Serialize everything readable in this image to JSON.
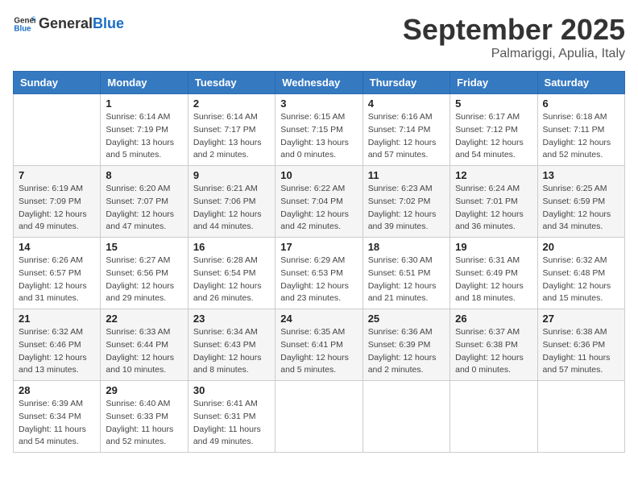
{
  "logo": {
    "text_general": "General",
    "text_blue": "Blue"
  },
  "header": {
    "month": "September 2025",
    "location": "Palmariggi, Apulia, Italy"
  },
  "days_of_week": [
    "Sunday",
    "Monday",
    "Tuesday",
    "Wednesday",
    "Thursday",
    "Friday",
    "Saturday"
  ],
  "weeks": [
    [
      {
        "day": "",
        "info": ""
      },
      {
        "day": "1",
        "info": "Sunrise: 6:14 AM\nSunset: 7:19 PM\nDaylight: 13 hours\nand 5 minutes."
      },
      {
        "day": "2",
        "info": "Sunrise: 6:14 AM\nSunset: 7:17 PM\nDaylight: 13 hours\nand 2 minutes."
      },
      {
        "day": "3",
        "info": "Sunrise: 6:15 AM\nSunset: 7:15 PM\nDaylight: 13 hours\nand 0 minutes."
      },
      {
        "day": "4",
        "info": "Sunrise: 6:16 AM\nSunset: 7:14 PM\nDaylight: 12 hours\nand 57 minutes."
      },
      {
        "day": "5",
        "info": "Sunrise: 6:17 AM\nSunset: 7:12 PM\nDaylight: 12 hours\nand 54 minutes."
      },
      {
        "day": "6",
        "info": "Sunrise: 6:18 AM\nSunset: 7:11 PM\nDaylight: 12 hours\nand 52 minutes."
      }
    ],
    [
      {
        "day": "7",
        "info": "Sunrise: 6:19 AM\nSunset: 7:09 PM\nDaylight: 12 hours\nand 49 minutes."
      },
      {
        "day": "8",
        "info": "Sunrise: 6:20 AM\nSunset: 7:07 PM\nDaylight: 12 hours\nand 47 minutes."
      },
      {
        "day": "9",
        "info": "Sunrise: 6:21 AM\nSunset: 7:06 PM\nDaylight: 12 hours\nand 44 minutes."
      },
      {
        "day": "10",
        "info": "Sunrise: 6:22 AM\nSunset: 7:04 PM\nDaylight: 12 hours\nand 42 minutes."
      },
      {
        "day": "11",
        "info": "Sunrise: 6:23 AM\nSunset: 7:02 PM\nDaylight: 12 hours\nand 39 minutes."
      },
      {
        "day": "12",
        "info": "Sunrise: 6:24 AM\nSunset: 7:01 PM\nDaylight: 12 hours\nand 36 minutes."
      },
      {
        "day": "13",
        "info": "Sunrise: 6:25 AM\nSunset: 6:59 PM\nDaylight: 12 hours\nand 34 minutes."
      }
    ],
    [
      {
        "day": "14",
        "info": "Sunrise: 6:26 AM\nSunset: 6:57 PM\nDaylight: 12 hours\nand 31 minutes."
      },
      {
        "day": "15",
        "info": "Sunrise: 6:27 AM\nSunset: 6:56 PM\nDaylight: 12 hours\nand 29 minutes."
      },
      {
        "day": "16",
        "info": "Sunrise: 6:28 AM\nSunset: 6:54 PM\nDaylight: 12 hours\nand 26 minutes."
      },
      {
        "day": "17",
        "info": "Sunrise: 6:29 AM\nSunset: 6:53 PM\nDaylight: 12 hours\nand 23 minutes."
      },
      {
        "day": "18",
        "info": "Sunrise: 6:30 AM\nSunset: 6:51 PM\nDaylight: 12 hours\nand 21 minutes."
      },
      {
        "day": "19",
        "info": "Sunrise: 6:31 AM\nSunset: 6:49 PM\nDaylight: 12 hours\nand 18 minutes."
      },
      {
        "day": "20",
        "info": "Sunrise: 6:32 AM\nSunset: 6:48 PM\nDaylight: 12 hours\nand 15 minutes."
      }
    ],
    [
      {
        "day": "21",
        "info": "Sunrise: 6:32 AM\nSunset: 6:46 PM\nDaylight: 12 hours\nand 13 minutes."
      },
      {
        "day": "22",
        "info": "Sunrise: 6:33 AM\nSunset: 6:44 PM\nDaylight: 12 hours\nand 10 minutes."
      },
      {
        "day": "23",
        "info": "Sunrise: 6:34 AM\nSunset: 6:43 PM\nDaylight: 12 hours\nand 8 minutes."
      },
      {
        "day": "24",
        "info": "Sunrise: 6:35 AM\nSunset: 6:41 PM\nDaylight: 12 hours\nand 5 minutes."
      },
      {
        "day": "25",
        "info": "Sunrise: 6:36 AM\nSunset: 6:39 PM\nDaylight: 12 hours\nand 2 minutes."
      },
      {
        "day": "26",
        "info": "Sunrise: 6:37 AM\nSunset: 6:38 PM\nDaylight: 12 hours\nand 0 minutes."
      },
      {
        "day": "27",
        "info": "Sunrise: 6:38 AM\nSunset: 6:36 PM\nDaylight: 11 hours\nand 57 minutes."
      }
    ],
    [
      {
        "day": "28",
        "info": "Sunrise: 6:39 AM\nSunset: 6:34 PM\nDaylight: 11 hours\nand 54 minutes."
      },
      {
        "day": "29",
        "info": "Sunrise: 6:40 AM\nSunset: 6:33 PM\nDaylight: 11 hours\nand 52 minutes."
      },
      {
        "day": "30",
        "info": "Sunrise: 6:41 AM\nSunset: 6:31 PM\nDaylight: 11 hours\nand 49 minutes."
      },
      {
        "day": "",
        "info": ""
      },
      {
        "day": "",
        "info": ""
      },
      {
        "day": "",
        "info": ""
      },
      {
        "day": "",
        "info": ""
      }
    ]
  ]
}
